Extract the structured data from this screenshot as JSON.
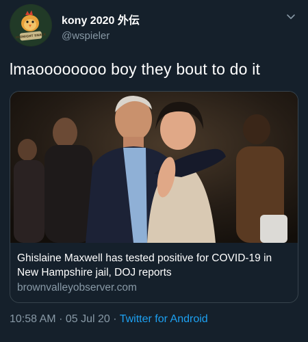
{
  "author": {
    "display_name": "kony 2020 外伝",
    "handle": "@wspieler",
    "avatar_icon": "cartoon-chicken-avatar",
    "avatar_badge_text": "MIDNIGHT SNACK"
  },
  "tweet": {
    "text": "lmaoooooooo boy they bout to do it",
    "timestamp": "10:58 AM",
    "date": "05 Jul 20",
    "separator": "·",
    "client": "Twitter for Android"
  },
  "card": {
    "title": "Ghislaine Maxwell has tested positive for COVID-19 in New Hampshire jail, DOJ reports",
    "domain": "brownvalleyobserver.com"
  },
  "colors": {
    "background": "#15202b",
    "text_primary": "#ffffff",
    "text_secondary": "#8899a6",
    "link": "#1da1f2",
    "border": "#38444d"
  }
}
